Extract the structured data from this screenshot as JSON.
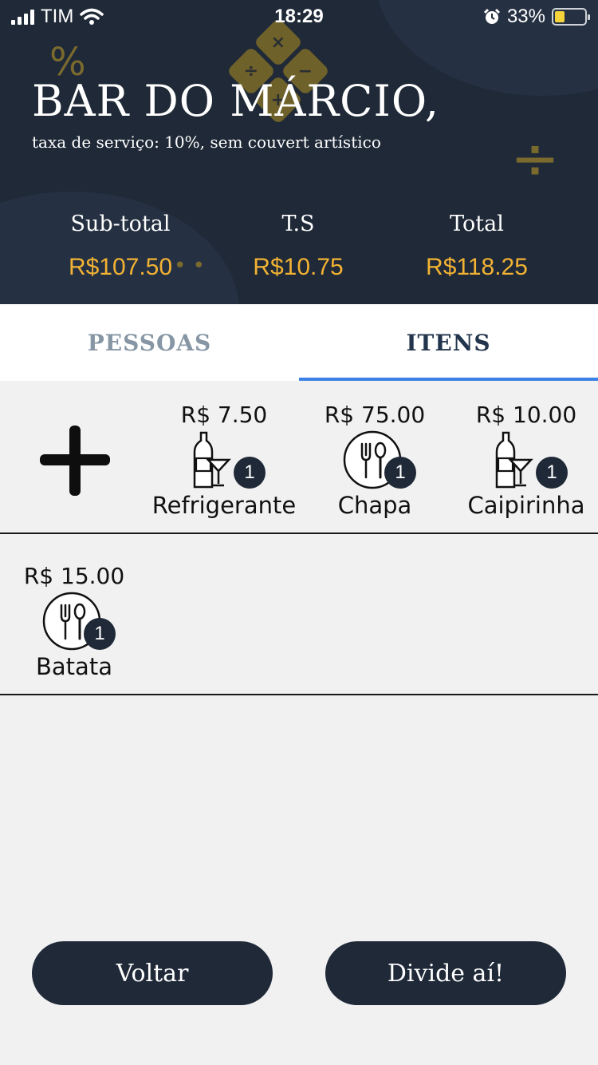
{
  "status_bar": {
    "carrier": "TIM",
    "time": "18:29",
    "battery_percent": "33%",
    "battery_level": 0.33,
    "icons": [
      "signal-icon",
      "wifi-icon",
      "alarm-icon",
      "battery-icon"
    ]
  },
  "header": {
    "venue_name": "BAR DO MÁRCIO,",
    "subtitle": "taxa de serviço: 10%, sem couvert artístico",
    "summary": [
      {
        "label": "Sub-total",
        "value": "R$107.50"
      },
      {
        "label": "T.S",
        "value": "R$10.75"
      },
      {
        "label": "Total",
        "value": "R$118.25"
      }
    ],
    "accent_color": "#f2b233",
    "background_color": "#1f2937"
  },
  "tabs": [
    {
      "label": "PESSOAS",
      "active": false
    },
    {
      "label": "ITENS",
      "active": true
    }
  ],
  "items": [
    {
      "price": "R$ 7.50",
      "name": "Refrigerante",
      "count": "1",
      "icon": "drinks-icon"
    },
    {
      "price": "R$ 75.00",
      "name": "Chapa",
      "count": "1",
      "icon": "cutlery-icon"
    },
    {
      "price": "R$ 10.00",
      "name": "Caipirinha",
      "count": "1",
      "icon": "drinks-icon"
    },
    {
      "price": "R$ 15.00",
      "name": "Batata",
      "count": "1",
      "icon": "cutlery-icon"
    }
  ],
  "add_item_icon": "plus-icon",
  "footer": {
    "back_label": "Voltar",
    "split_label": "Divide aí!"
  }
}
